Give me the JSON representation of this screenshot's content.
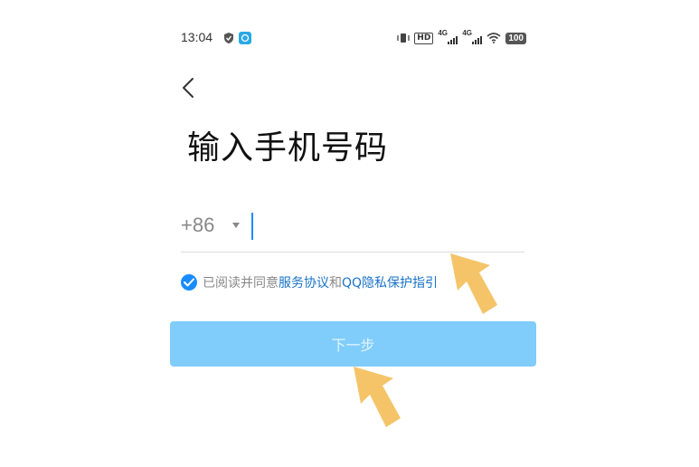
{
  "status_bar": {
    "time": "13:04",
    "hd_label": "HD",
    "signal1_label": "4G",
    "signal2_label": "4G",
    "battery": "100"
  },
  "page": {
    "title": "输入手机号码"
  },
  "phone_input": {
    "country_code": "+86",
    "value": "",
    "placeholder": ""
  },
  "agreement": {
    "prefix": "已阅读并同意",
    "link1": "服务协议",
    "middle": "和",
    "link2": "QQ隐私保护指引"
  },
  "next_button": {
    "label": "下一步",
    "enabled": false
  },
  "colors": {
    "accent": "#1a8cff",
    "button_disabled": "#80cdfb",
    "link": "#1a73c8",
    "annotation_arrow": "#f5c469"
  },
  "icons": [
    "back-chevron-icon",
    "caret-down-icon",
    "checkmark-icon",
    "wifi-icon",
    "vibrate-icon",
    "shield-icon",
    "app-icon"
  ]
}
